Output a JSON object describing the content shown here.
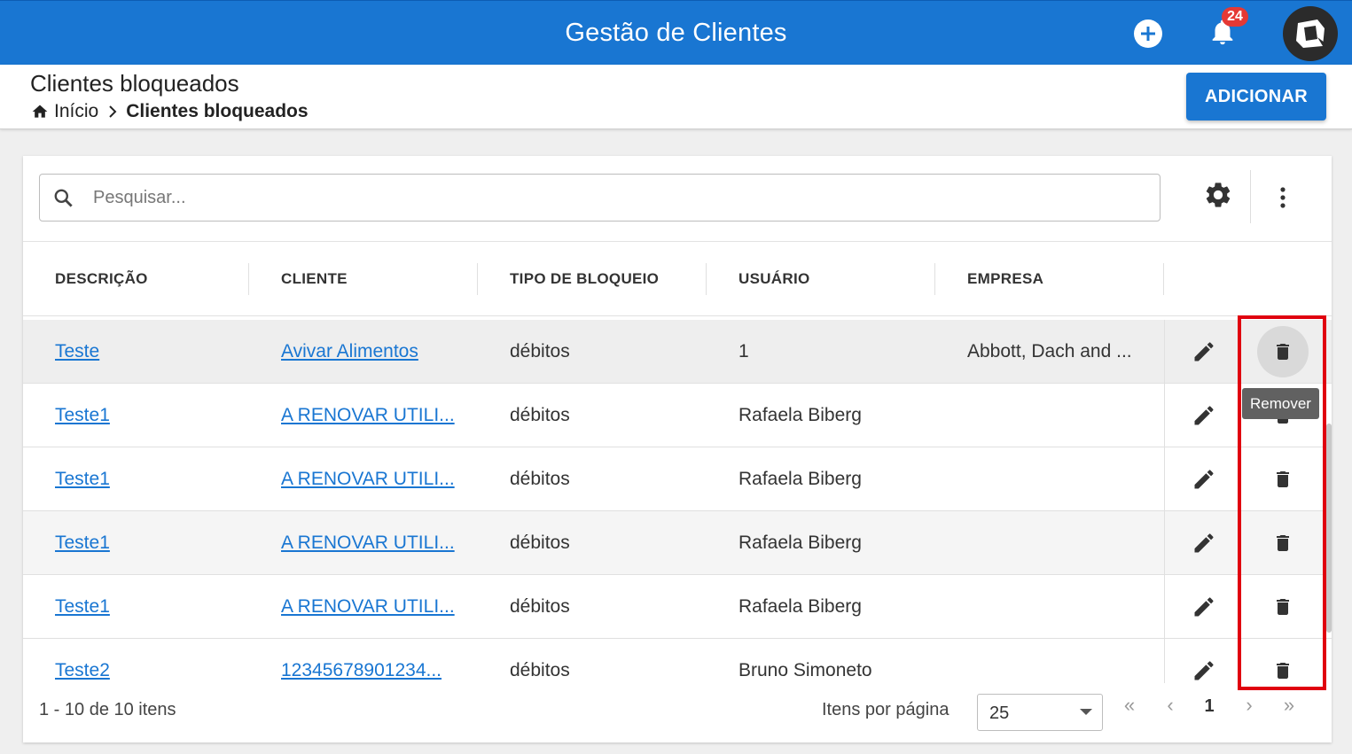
{
  "appbar": {
    "title": "Gestão de Clientes",
    "notification_count": "24",
    "color": "#1976d2"
  },
  "page": {
    "title": "Clientes bloqueados",
    "breadcrumb": {
      "home": "Início",
      "current": "Clientes bloqueados"
    },
    "add_button": "ADICIONAR"
  },
  "search": {
    "placeholder": "Pesquisar..."
  },
  "table": {
    "columns": [
      "DESCRIÇÃO",
      "CLIENTE",
      "TIPO DE BLOQUEIO",
      "USUÁRIO",
      "EMPRESA"
    ],
    "rows": [
      {
        "descricao": "Teste",
        "cliente": "Avivar Alimentos",
        "tipo": "débitos",
        "usuario": "1",
        "empresa": "Abbott, Dach and ..."
      },
      {
        "descricao": "Teste1",
        "cliente": "A RENOVAR UTILI...",
        "tipo": "débitos",
        "usuario": "Rafaela Biberg",
        "empresa": ""
      },
      {
        "descricao": "Teste1",
        "cliente": "A RENOVAR UTILI...",
        "tipo": "débitos",
        "usuario": "Rafaela Biberg",
        "empresa": ""
      },
      {
        "descricao": "Teste1",
        "cliente": "A RENOVAR UTILI...",
        "tipo": "débitos",
        "usuario": "Rafaela Biberg",
        "empresa": ""
      },
      {
        "descricao": "Teste1",
        "cliente": "A RENOVAR UTILI...",
        "tipo": "débitos",
        "usuario": "Rafaela Biberg",
        "empresa": ""
      },
      {
        "descricao": "Teste2",
        "cliente": "12345678901234...",
        "tipo": "débitos",
        "usuario": "Bruno Simoneto",
        "empresa": ""
      }
    ],
    "row_actions": {
      "edit_icon": "pencil-icon",
      "delete_icon": "trash-icon"
    },
    "tooltip": "Remover"
  },
  "footer": {
    "range": "1 - 10 de 10 itens",
    "items_per_page_label": "Itens por página",
    "items_per_page_value": "25",
    "first": "«",
    "prev": "‹",
    "page": "1",
    "next": "›",
    "last": "»"
  },
  "highlight_color": "#e0000f"
}
